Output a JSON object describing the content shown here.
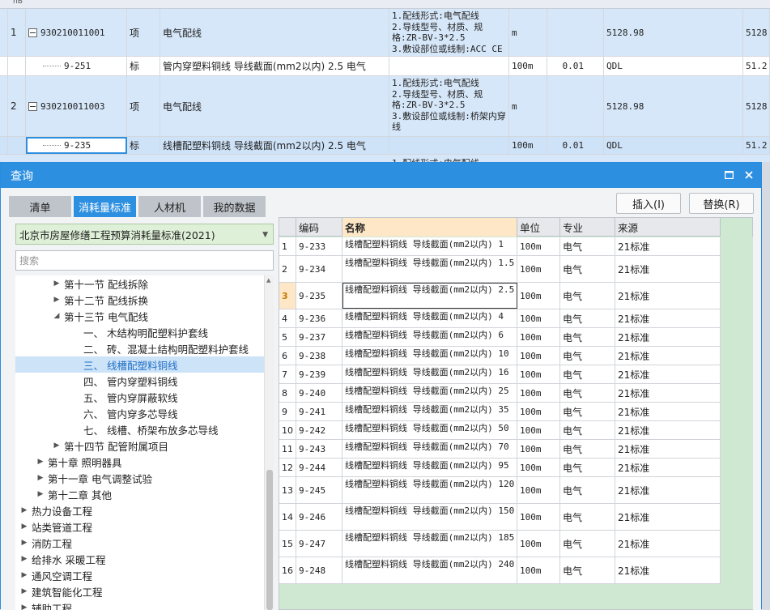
{
  "background_grid": {
    "header_fragment": "hB",
    "rows": [
      {
        "no": "1",
        "code": "930210011001",
        "type": "项",
        "name": "电气配线",
        "features": "1.配线形式:电气配线\n2.导线型号、材质、规格:ZR-BV-3*2.5\n3.敷设部位或线制:ACC CE",
        "unit": "m",
        "qty": "",
        "price": "5128.98",
        "total": "5128"
      },
      {
        "no": "",
        "code": "9-251",
        "type": "标",
        "name": "管内穿塑料铜线 导线截面(mm2以内) 2.5 电气",
        "features": "",
        "unit": "100m",
        "qty": "0.01",
        "price": "QDL",
        "total": "51.2"
      },
      {
        "no": "2",
        "code": "930210011003",
        "type": "项",
        "name": "电气配线",
        "features": "1.配线形式:电气配线\n2.导线型号、材质、规格:ZR-BV-3*2.5\n3.敷设部位或线制:桥架内穿线",
        "unit": "m",
        "qty": "",
        "price": "5128.98",
        "total": "5128"
      },
      {
        "no": "",
        "code": "9-235",
        "type": "标",
        "name": "线槽配塑料铜线 导线截面(mm2以内) 2.5 电气",
        "features": "",
        "unit": "100m",
        "qty": "0.01",
        "price": "QDL",
        "total": "51.2"
      }
    ],
    "partial_text": "1.配线形式:电气配线"
  },
  "dialog": {
    "title": "查询",
    "tabs": [
      "清单",
      "消耗量标准",
      "人材机",
      "我的数据"
    ],
    "active_tab": "消耗量标准",
    "insert_button": "插入(I)",
    "replace_button": "替换(R)",
    "standard_select": "北京市房屋修缮工程预算消耗量标准(2021)",
    "search_placeholder": "搜索",
    "tree": [
      {
        "label": "第十一节 配线拆除",
        "level": 2,
        "arrow": "▶"
      },
      {
        "label": "第十二节 配线拆换",
        "level": 2,
        "arrow": "▶"
      },
      {
        "label": "第十三节 电气配线",
        "level": 2,
        "arrow": "◢"
      },
      {
        "label": "一、 木结构明配塑料护套线",
        "level": 3,
        "arrow": ""
      },
      {
        "label": "二、 砖、混凝土结构明配塑料护套线",
        "level": 3,
        "arrow": ""
      },
      {
        "label": "三、 线槽配塑料铜线",
        "level": 3,
        "arrow": "",
        "highlight": true
      },
      {
        "label": "四、 管内穿塑料铜线",
        "level": 3,
        "arrow": ""
      },
      {
        "label": "五、 管内穿屏蔽软线",
        "level": 3,
        "arrow": ""
      },
      {
        "label": "六、 管内穿多芯导线",
        "level": 3,
        "arrow": ""
      },
      {
        "label": "七、 线槽、桥架布放多芯导线",
        "level": 3,
        "arrow": ""
      },
      {
        "label": "第十四节 配管附属项目",
        "level": 2,
        "arrow": "▶"
      },
      {
        "label": "第十章 照明器具",
        "level": 1,
        "arrow": "▶"
      },
      {
        "label": "第十一章 电气调整试验",
        "level": 1,
        "arrow": "▶"
      },
      {
        "label": "第十二章 其他",
        "level": 1,
        "arrow": "▶"
      },
      {
        "label": "热力设备工程",
        "level": 0,
        "arrow": "▶"
      },
      {
        "label": "站类管道工程",
        "level": 0,
        "arrow": "▶"
      },
      {
        "label": "消防工程",
        "level": 0,
        "arrow": "▶"
      },
      {
        "label": "给排水 采暖工程",
        "level": 0,
        "arrow": "▶"
      },
      {
        "label": "通风空调工程",
        "level": 0,
        "arrow": "▶"
      },
      {
        "label": "建筑智能化工程",
        "level": 0,
        "arrow": "▶"
      },
      {
        "label": "辅助工程",
        "level": 0,
        "arrow": "▶"
      }
    ],
    "table": {
      "headers": [
        "",
        "编码",
        "名称",
        "单位",
        "专业",
        "来源"
      ],
      "selected_row": 3,
      "rows": [
        {
          "idx": "1",
          "code": "9-233",
          "name": "线槽配塑料铜线 导线截面(mm2以内) 1",
          "unit": "100m",
          "spec": "电气",
          "src": "21标准",
          "tall": false
        },
        {
          "idx": "2",
          "code": "9-234",
          "name": "线槽配塑料铜线 导线截面(mm2以内) 1.5",
          "unit": "100m",
          "spec": "电气",
          "src": "21标准",
          "tall": true
        },
        {
          "idx": "3",
          "code": "9-235",
          "name": "线槽配塑料铜线 导线截面(mm2以内) 2.5",
          "unit": "100m",
          "spec": "电气",
          "src": "21标准",
          "tall": true
        },
        {
          "idx": "4",
          "code": "9-236",
          "name": "线槽配塑料铜线 导线截面(mm2以内) 4",
          "unit": "100m",
          "spec": "电气",
          "src": "21标准",
          "tall": false
        },
        {
          "idx": "5",
          "code": "9-237",
          "name": "线槽配塑料铜线 导线截面(mm2以内) 6",
          "unit": "100m",
          "spec": "电气",
          "src": "21标准",
          "tall": false
        },
        {
          "idx": "6",
          "code": "9-238",
          "name": "线槽配塑料铜线 导线截面(mm2以内) 10",
          "unit": "100m",
          "spec": "电气",
          "src": "21标准",
          "tall": false
        },
        {
          "idx": "7",
          "code": "9-239",
          "name": "线槽配塑料铜线 导线截面(mm2以内) 16",
          "unit": "100m",
          "spec": "电气",
          "src": "21标准",
          "tall": false
        },
        {
          "idx": "8",
          "code": "9-240",
          "name": "线槽配塑料铜线 导线截面(mm2以内) 25",
          "unit": "100m",
          "spec": "电气",
          "src": "21标准",
          "tall": false
        },
        {
          "idx": "9",
          "code": "9-241",
          "name": "线槽配塑料铜线 导线截面(mm2以内) 35",
          "unit": "100m",
          "spec": "电气",
          "src": "21标准",
          "tall": false
        },
        {
          "idx": "10",
          "code": "9-242",
          "name": "线槽配塑料铜线 导线截面(mm2以内) 50",
          "unit": "100m",
          "spec": "电气",
          "src": "21标准",
          "tall": false
        },
        {
          "idx": "11",
          "code": "9-243",
          "name": "线槽配塑料铜线 导线截面(mm2以内) 70",
          "unit": "100m",
          "spec": "电气",
          "src": "21标准",
          "tall": false
        },
        {
          "idx": "12",
          "code": "9-244",
          "name": "线槽配塑料铜线 导线截面(mm2以内) 95",
          "unit": "100m",
          "spec": "电气",
          "src": "21标准",
          "tall": false
        },
        {
          "idx": "13",
          "code": "9-245",
          "name": "线槽配塑料铜线 导线截面(mm2以内) 120",
          "unit": "100m",
          "spec": "电气",
          "src": "21标准",
          "tall": true
        },
        {
          "idx": "14",
          "code": "9-246",
          "name": "线槽配塑料铜线 导线截面(mm2以内) 150",
          "unit": "100m",
          "spec": "电气",
          "src": "21标准",
          "tall": true
        },
        {
          "idx": "15",
          "code": "9-247",
          "name": "线槽配塑料铜线 导线截面(mm2以内) 185",
          "unit": "100m",
          "spec": "电气",
          "src": "21标准",
          "tall": true
        },
        {
          "idx": "16",
          "code": "9-248",
          "name": "线槽配塑料铜线 导线截面(mm2以内) 240",
          "unit": "100m",
          "spec": "电气",
          "src": "21标准",
          "tall": true
        }
      ]
    }
  },
  "colors": {
    "accent": "#2d8fe0",
    "row_blue": "#d6e7f9",
    "select_green": "#dff0d8",
    "table_bg": "#cfe8d2"
  }
}
